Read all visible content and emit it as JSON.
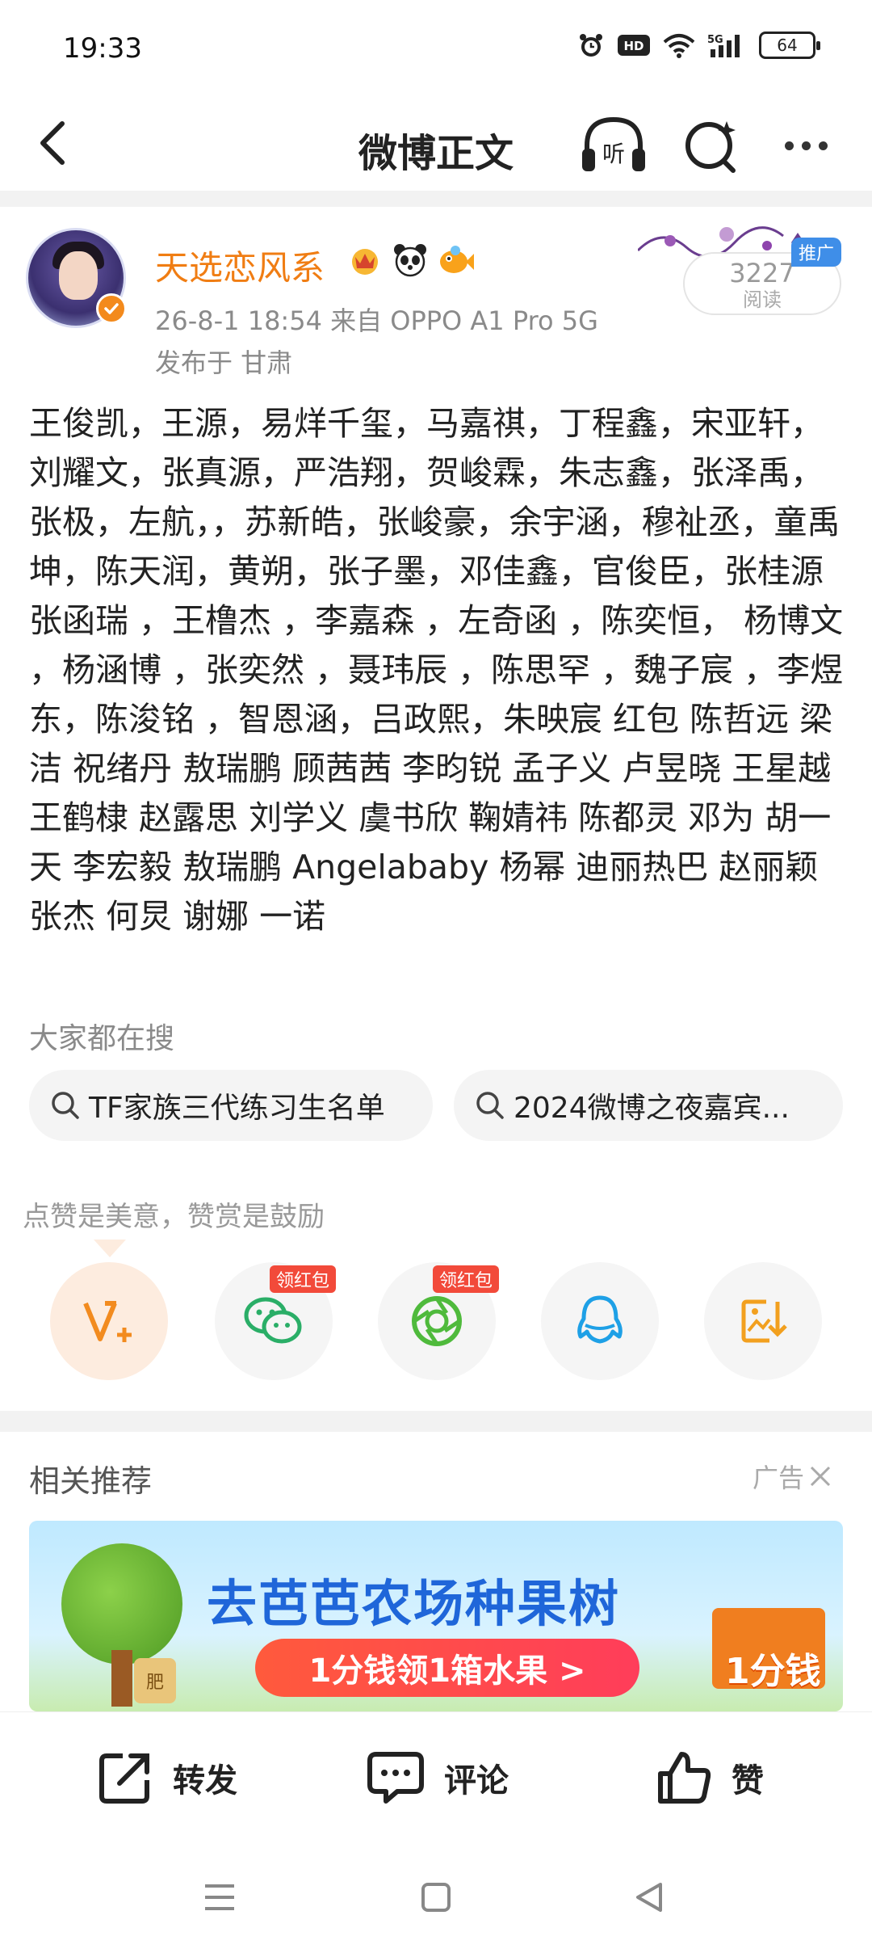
{
  "status_bar": {
    "time": "19:33",
    "hd_label": "HD",
    "network_label": "5G",
    "battery_level": "64"
  },
  "nav": {
    "title": "微博正文",
    "listen_label": "听"
  },
  "post": {
    "username": "天选恋风系",
    "meta": "26-8-1 18:54   来自 OPPO A1 Pro 5G",
    "location": "发布于 甘肃",
    "read_count": "3227",
    "read_label": "阅读",
    "promo_tag": "推广",
    "body": "王俊凯，王源，易烊千玺，马嘉祺，丁程鑫，宋亚轩，刘耀文，张真源，严浩翔，贺峻霖，朱志鑫，张泽禹，张极，左航，，苏新皓，张峻豪，余宇涵，穆祉丞，童禹坤，陈天润，黄朔，张子墨，邓佳鑫，官俊臣，张桂源 张函瑞 ，王橹杰 ，李嘉森 ，左奇函 ，陈奕恒， 杨博文 ，杨涵博 ，张奕然 ，聂玮辰 ，陈思罕 ，魏子宸 ，李煜东，陈浚铭 ，智恩涵，吕政熙，朱映宸 红包 陈哲远 梁洁 祝绪丹 敖瑞鹏 顾茜茜 李昀锐 孟子义 卢昱晓 王星越 王鹤棣 赵露思 刘学义 虞书欣 鞠婧祎 陈都灵 邓为 胡一天 李宏毅 敖瑞鹏 Angelababy 杨幂 迪丽热巴 赵丽颖 张杰 何炅 谢娜 一诺"
  },
  "search": {
    "heading": "大家都在搜",
    "chips": [
      "TF家族三代练习生名单",
      "2024微博之夜嘉宾..."
    ]
  },
  "tip": "点赞是美意，赞赏是鼓励",
  "share": {
    "red_packet_label": "领红包"
  },
  "recommend": {
    "title": "相关推荐",
    "ad_label": "广告"
  },
  "banner": {
    "title": "去芭芭农场种果树",
    "button": "1分钱领1箱水果 >",
    "price": "1分钱",
    "tree_label": "肥"
  },
  "actions": {
    "repost": "转发",
    "comment": "评论",
    "like": "赞"
  },
  "colors": {
    "accent_orange": "#f07d13",
    "promo_blue": "#3f8ee8",
    "red_tag": "#f24a3a"
  }
}
